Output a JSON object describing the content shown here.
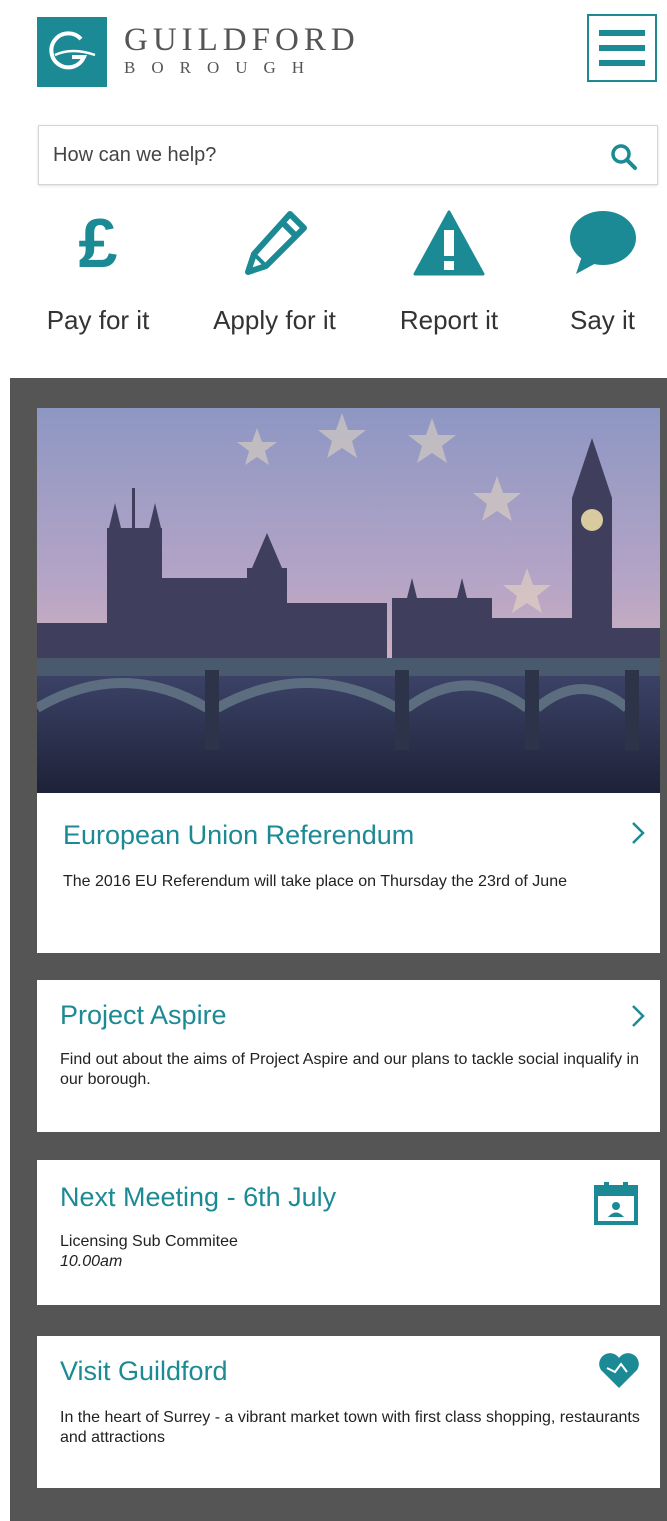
{
  "header": {
    "logo_main": "GUILDFORD",
    "logo_sub": "BOROUGH",
    "menu_icon": "hamburger-menu-icon"
  },
  "search": {
    "placeholder": "How can we help?",
    "icon": "search-icon"
  },
  "quick_actions": [
    {
      "label": "Pay for it",
      "icon": "pound-icon",
      "glyph": "£"
    },
    {
      "label": "Apply for it",
      "icon": "pencil-icon"
    },
    {
      "label": "Report it",
      "icon": "warning-icon"
    },
    {
      "label": "Say it",
      "icon": "speech-bubble-icon"
    }
  ],
  "cards": [
    {
      "title": "European Union Referendum",
      "text": "The 2016 EU Referendum will take place on Thursday the 23rd of June",
      "icon": "chevron-right-icon",
      "image": "westminster-eu-flag-image"
    },
    {
      "title": "Project Aspire",
      "text": "Find out about the aims of Project Aspire and our plans to tackle social inqualify in our borough.",
      "icon": "chevron-right-icon"
    },
    {
      "title": "Next Meeting - 6th July",
      "text": "Licensing Sub Commitee",
      "time": "10.00am",
      "icon": "calendar-icon"
    },
    {
      "title": "Visit Guildford",
      "text": "In the heart of Surrey - a vibrant market town with first class shopping, restaurants and attractions",
      "icon": "heart-icon"
    }
  ],
  "colors": {
    "brand": "#1c8a94",
    "background": "#555555"
  }
}
